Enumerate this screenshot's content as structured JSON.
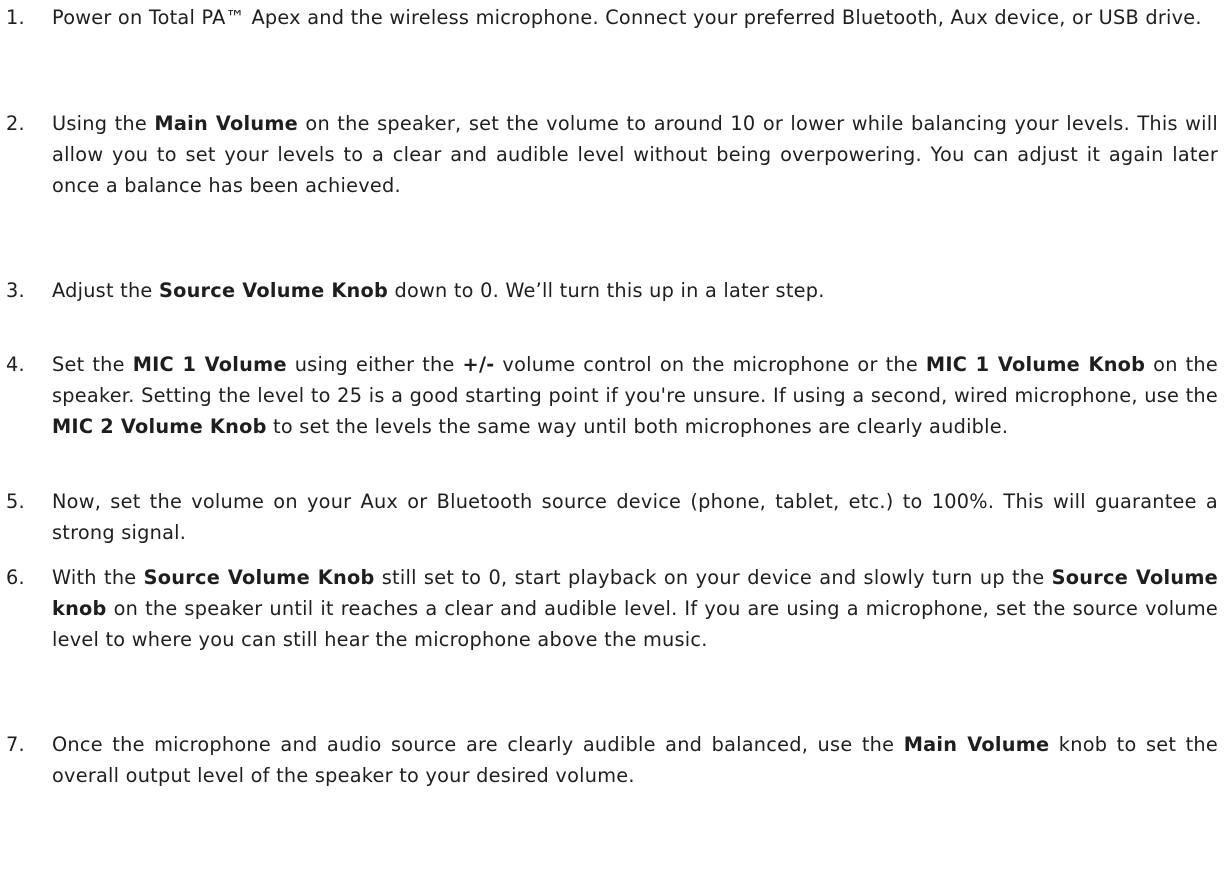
{
  "steps": [
    {
      "num": "1.",
      "segments": [
        {
          "t": "Power on Total PA™ Apex and the wireless microphone. Connect your preferred Bluetooth, Aux device, or USB drive.",
          "b": false
        }
      ]
    },
    {
      "num": "2.",
      "segments": [
        {
          "t": "Using the ",
          "b": false
        },
        {
          "t": "Main Volume",
          "b": true
        },
        {
          "t": " on the speaker, set the volume to around 10 or lower while balancing your levels. This will allow you to set your levels to a clear and audible level without being overpowering. You can adjust it again later once a balance has been achieved.",
          "b": false
        }
      ]
    },
    {
      "num": "3.",
      "segments": [
        {
          "t": "Adjust the ",
          "b": false
        },
        {
          "t": "Source Volume Knob",
          "b": true
        },
        {
          "t": " down to 0. We’ll turn this up in a later step.",
          "b": false
        }
      ]
    },
    {
      "num": "4.",
      "segments": [
        {
          "t": "Set the ",
          "b": false
        },
        {
          "t": "MIC 1 Volume",
          "b": true
        },
        {
          "t": " using either the ",
          "b": false
        },
        {
          "t": "+/-",
          "b": true
        },
        {
          "t": " volume control on the microphone or the ",
          "b": false
        },
        {
          "t": "MIC 1 Volume Knob",
          "b": true
        },
        {
          "t": " on the speaker. Setting the level to 25 is a good starting point if you're unsure. If using a second, wired microphone, use the ",
          "b": false
        },
        {
          "t": "MIC 2 Volume Knob",
          "b": true
        },
        {
          "t": " to set the levels the same way until both microphones are clearly audible.",
          "b": false
        }
      ]
    },
    {
      "num": "5.",
      "segments": [
        {
          "t": "Now, set the volume on your Aux or Bluetooth source device (phone, tablet, etc.) to 100%. This will guarantee a strong signal.",
          "b": false
        }
      ]
    },
    {
      "num": "6.",
      "segments": [
        {
          "t": "With the ",
          "b": false
        },
        {
          "t": "Source Volume Knob",
          "b": true
        },
        {
          "t": " still set to 0, start playback on your device and slowly turn up the ",
          "b": false
        },
        {
          "t": "Source Volume knob",
          "b": true
        },
        {
          "t": " on the speaker until it reaches a clear and audible level. If you are using a microphone, set the source volume level to where you can still hear the microphone above the music.",
          "b": false
        }
      ]
    },
    {
      "num": "7.",
      "segments": [
        {
          "t": "Once the microphone and audio source are clearly audible and balanced, use the ",
          "b": false
        },
        {
          "t": "Main Volume",
          "b": true
        },
        {
          "t": " knob to set the overall output level of the speaker to your desired volume.",
          "b": false
        }
      ]
    }
  ]
}
